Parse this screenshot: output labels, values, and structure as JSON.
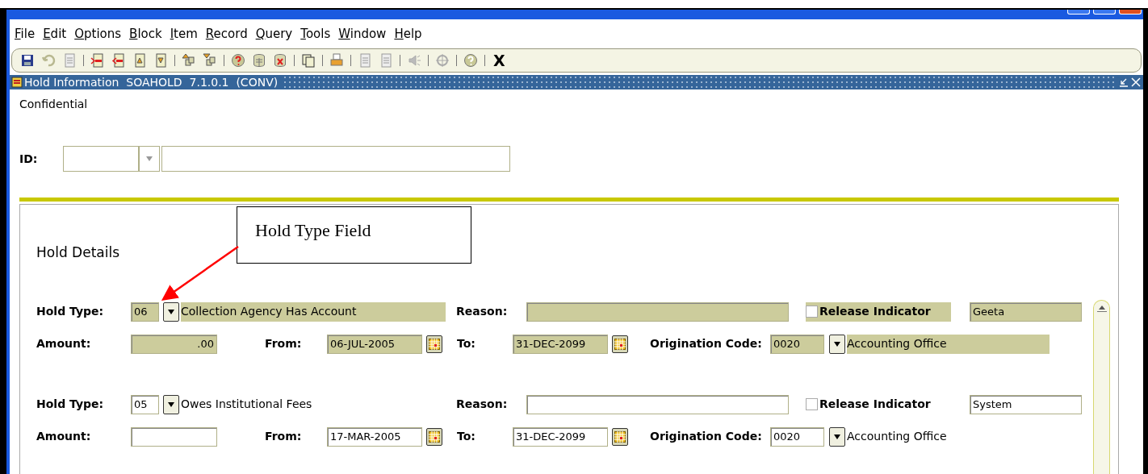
{
  "menu": [
    "File",
    "Edit",
    "Options",
    "Block",
    "Item",
    "Record",
    "Query",
    "Tools",
    "Window",
    "Help"
  ],
  "toolbar": {
    "exit_label": "X"
  },
  "window": {
    "title": "Hold Information  SOAHOLD  7.1.0.1  (CONV)"
  },
  "header": {
    "confidential_label": "Confidential",
    "id_label": "ID:"
  },
  "section": {
    "title": "Hold Details"
  },
  "records": [
    {
      "selected": true,
      "hold_type_label": "Hold Type:",
      "hold_type_code": "06",
      "hold_type_desc": "Collection Agency Has Account",
      "reason_label": "Reason:",
      "release_checked": false,
      "release_label": "Release Indicator",
      "user": "Geeta",
      "amount_label": "Amount:",
      "amount": ".00",
      "from_label": "From:",
      "from": "06-JUL-2005",
      "to_label": "To:",
      "to": "31-DEC-2099",
      "origination_label": "Origination Code:",
      "origination_code": "0020",
      "origination_desc": "Accounting Office"
    },
    {
      "selected": false,
      "hold_type_label": "Hold Type:",
      "hold_type_code": "05",
      "hold_type_desc": "Owes Institutional Fees",
      "reason_label": "Reason:",
      "release_checked": false,
      "release_label": "Release Indicator",
      "user": "System",
      "amount_label": "Amount:",
      "from_label": "From:",
      "from": "17-MAR-2005",
      "to_label": "To:",
      "to": "31-DEC-2099",
      "origination_label": "Origination Code:",
      "origination_code": "0020",
      "origination_desc": "Accounting Office"
    }
  ],
  "annotation": {
    "text": "Hold Type Field"
  }
}
